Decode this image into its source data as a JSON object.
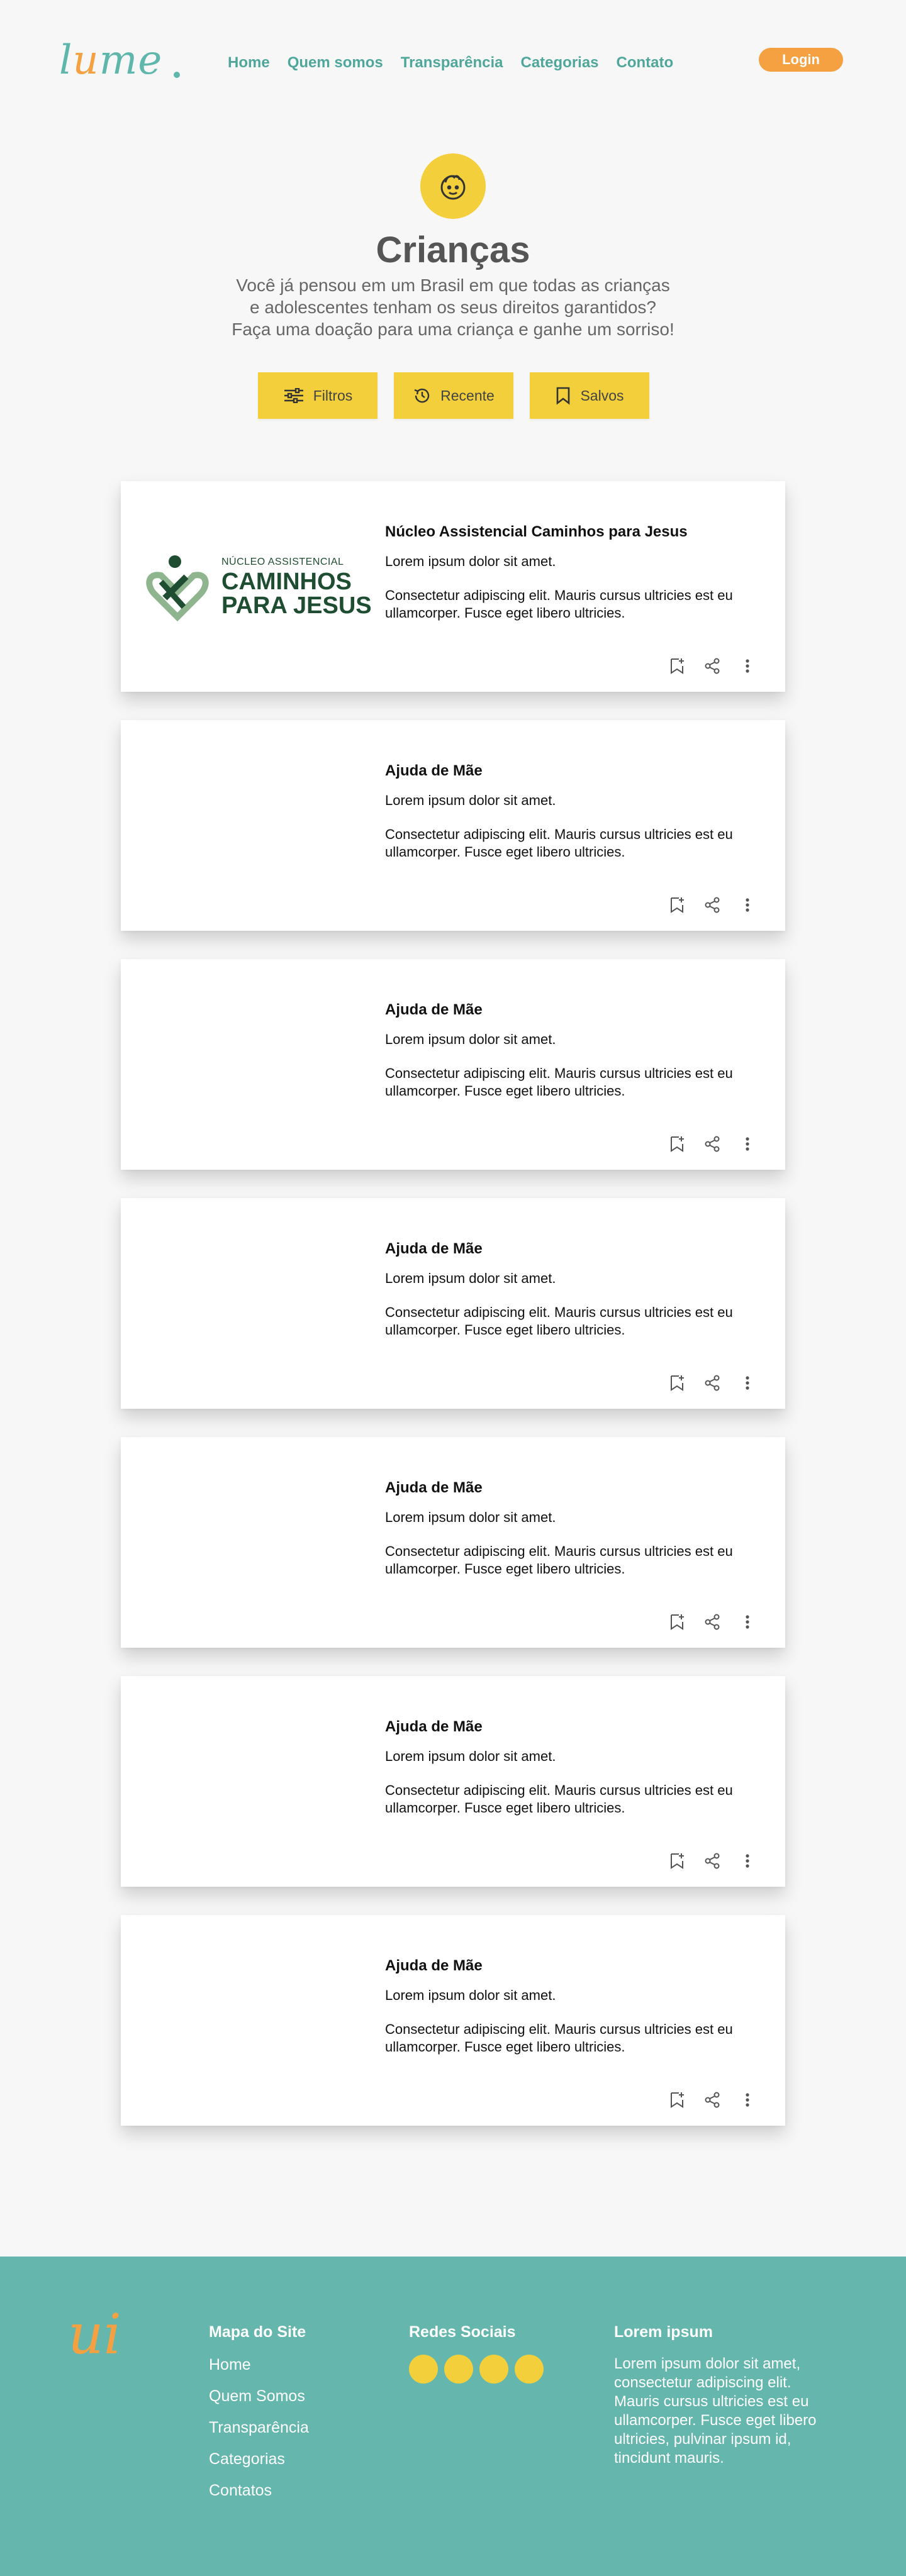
{
  "header": {
    "logo_text_before": "l",
    "logo_text_accent": "u",
    "logo_text_after": "me",
    "nav": [
      "Home",
      "Quem somos",
      "Transparência",
      "Categorias",
      "Contato"
    ],
    "login_label": "Login"
  },
  "hero": {
    "icon": "child-face-icon",
    "title": "Crianças",
    "subtitle_lines": [
      "Você já pensou em um Brasil em que todas as crianças",
      "e adolescentes tenham os seus direitos garantidos?",
      "Faça uma doação para uma criança e ganhe um sorriso!"
    ]
  },
  "filters": [
    {
      "label": "Filtros",
      "icon": "sliders-icon"
    },
    {
      "label": "Recente",
      "icon": "history-icon"
    },
    {
      "label": "Salvos",
      "icon": "bookmark-icon"
    }
  ],
  "cards": [
    {
      "title": "Núcleo Assistencial Caminhos para Jesus",
      "subtitle": "Lorem ipsum dolor sit amet.",
      "body": "Consectetur adipiscing elit. Mauris cursus ultricies est eu ullamcorper. Fusce eget libero ultricies.",
      "logo": {
        "line1": "NÚCLEO ASSISTENCIAL",
        "line2": "CAMINHOS",
        "line3": "PARA JESUS"
      }
    },
    {
      "title": "Ajuda de Mãe",
      "subtitle": "Lorem ipsum dolor sit amet.",
      "body": "Consectetur adipiscing elit. Mauris cursus ultricies est eu ullamcorper. Fusce eget libero ultricies."
    },
    {
      "title": "Ajuda de Mãe",
      "subtitle": "Lorem ipsum dolor sit amet.",
      "body": "Consectetur adipiscing elit. Mauris cursus ultricies est eu ullamcorper. Fusce eget libero ultricies."
    },
    {
      "title": "Ajuda de Mãe",
      "subtitle": "Lorem ipsum dolor sit amet.",
      "body": "Consectetur adipiscing elit. Mauris cursus ultricies est eu ullamcorper. Fusce eget libero ultricies."
    },
    {
      "title": "Ajuda de Mãe",
      "subtitle": "Lorem ipsum dolor sit amet.",
      "body": "Consectetur adipiscing elit. Mauris cursus ultricies est eu ullamcorper. Fusce eget libero ultricies."
    },
    {
      "title": "Ajuda de Mãe",
      "subtitle": "Lorem ipsum dolor sit amet.",
      "body": "Consectetur adipiscing elit. Mauris cursus ultricies est eu ullamcorper. Fusce eget libero ultricies."
    },
    {
      "title": "Ajuda de Mãe",
      "subtitle": "Lorem ipsum dolor sit amet.",
      "body": "Consectetur adipiscing elit. Mauris cursus ultricies est eu ullamcorper. Fusce eget libero ultricies."
    }
  ],
  "card_action_icons": [
    "bookmark-add-icon",
    "share-icon",
    "more-vertical-icon"
  ],
  "footer": {
    "logo_text": "ui",
    "sitemap_title": "Mapa do Site",
    "sitemap_links": [
      "Home",
      "Quem Somos",
      "Transparência",
      "Categorias",
      "Contatos"
    ],
    "social_title": "Redes Sociais",
    "social_icons": [
      "social-icon-1",
      "social-icon-2",
      "social-icon-3",
      "social-icon-4"
    ],
    "about_title": "Lorem ipsum",
    "about_text": "Lorem ipsum dolor sit amet, consectetur adipiscing elit. Mauris cursus ultricies est eu ullamcorper. Fusce eget libero ultricies, pulvinar ipsum id, tincidunt mauris."
  },
  "colors": {
    "accent_yellow": "#f2cf3b",
    "accent_orange": "#f5a142",
    "teal": "#65b7ad",
    "nav_teal": "#4fa79b",
    "logo_green_dark": "#1f4d32",
    "logo_green_light": "#8fb58f"
  }
}
